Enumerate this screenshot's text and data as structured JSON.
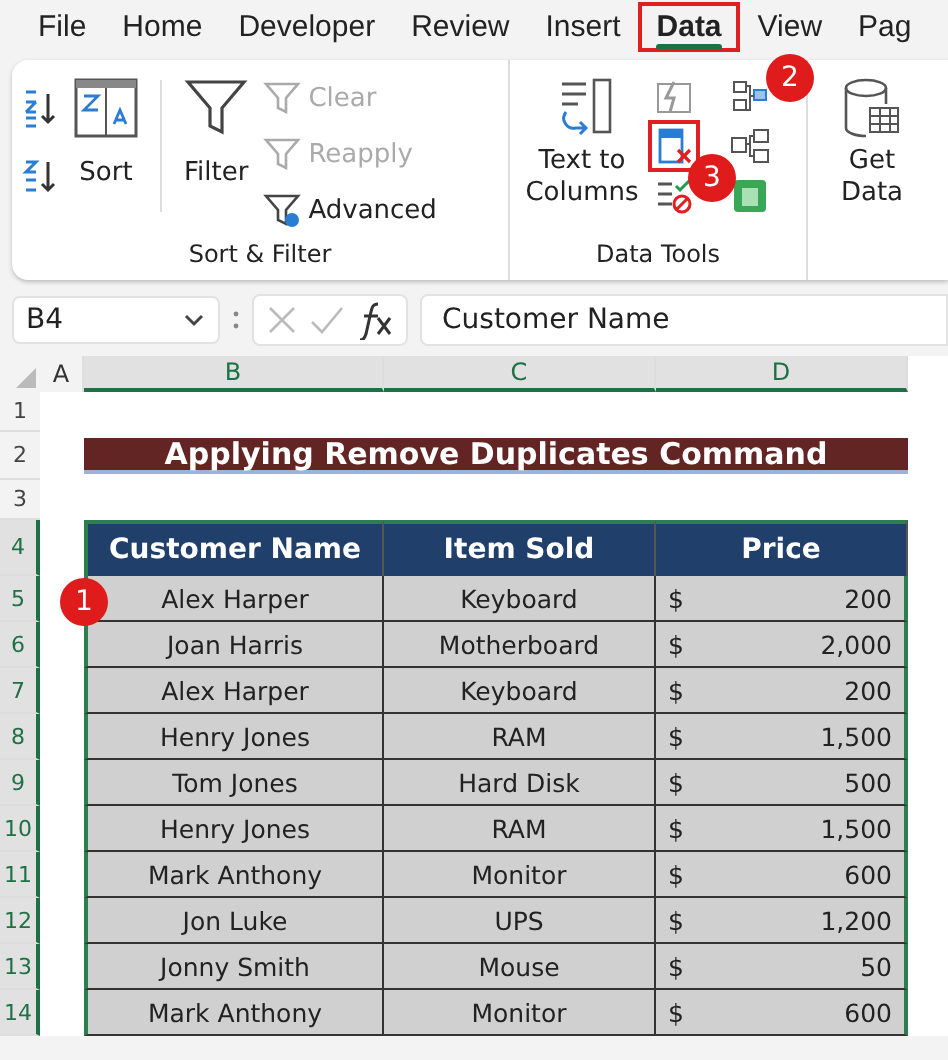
{
  "ribbon_tabs": [
    {
      "label": "File",
      "selected": false
    },
    {
      "label": "Home",
      "selected": false
    },
    {
      "label": "Developer",
      "selected": false
    },
    {
      "label": "Review",
      "selected": false
    },
    {
      "label": "Insert",
      "selected": false
    },
    {
      "label": "Data",
      "selected": true,
      "highlighted": true
    },
    {
      "label": "View",
      "selected": false
    },
    {
      "label": "Pag",
      "selected": false
    }
  ],
  "sort_filter": {
    "label": "Sort & Filter",
    "sort": "Sort",
    "filter": "Filter",
    "clear": {
      "label": "Clear",
      "disabled": true
    },
    "reapply": {
      "label": "Reapply",
      "disabled": true
    },
    "advanced": {
      "label": "Advanced",
      "disabled": false
    }
  },
  "data_tools": {
    "label": "Data Tools",
    "text_to_columns": "Text to Columns",
    "remove_duplicates_highlighted": true
  },
  "get_data": {
    "label": "Get Data"
  },
  "formula_bar": {
    "name_box": "B4",
    "formula": "Customer Name"
  },
  "columns": [
    {
      "label": "A",
      "selected": false
    },
    {
      "label": "B",
      "selected": true
    },
    {
      "label": "C",
      "selected": true
    },
    {
      "label": "D",
      "selected": true
    }
  ],
  "rows": [
    {
      "label": "1",
      "selected": false
    },
    {
      "label": "2",
      "selected": false
    },
    {
      "label": "3",
      "selected": false
    },
    {
      "label": "4",
      "selected": true
    },
    {
      "label": "5",
      "selected": true
    },
    {
      "label": "6",
      "selected": true
    },
    {
      "label": "7",
      "selected": true
    },
    {
      "label": "8",
      "selected": true
    },
    {
      "label": "9",
      "selected": true
    },
    {
      "label": "10",
      "selected": true
    },
    {
      "label": "11",
      "selected": true
    },
    {
      "label": "12",
      "selected": true
    },
    {
      "label": "13",
      "selected": true
    },
    {
      "label": "14",
      "selected": true
    }
  ],
  "sheet_title": "Applying Remove Duplicates Command",
  "table": {
    "headers": [
      "Customer Name",
      "Item Sold",
      "Price"
    ],
    "rows": [
      {
        "name": "Alex Harper",
        "item": "Keyboard",
        "currency": "$",
        "price": "200"
      },
      {
        "name": "Joan Harris",
        "item": "Motherboard",
        "currency": "$",
        "price": "2,000"
      },
      {
        "name": "Alex Harper",
        "item": "Keyboard",
        "currency": "$",
        "price": "200"
      },
      {
        "name": "Henry Jones",
        "item": "RAM",
        "currency": "$",
        "price": "1,500"
      },
      {
        "name": "Tom Jones",
        "item": "Hard Disk",
        "currency": "$",
        "price": "500"
      },
      {
        "name": "Henry Jones",
        "item": "RAM",
        "currency": "$",
        "price": "1,500"
      },
      {
        "name": "Mark Anthony",
        "item": "Monitor",
        "currency": "$",
        "price": "600"
      },
      {
        "name": "Jon Luke",
        "item": "UPS",
        "currency": "$",
        "price": "1,200"
      },
      {
        "name": "Jonny Smith",
        "item": "Mouse",
        "currency": "$",
        "price": "50"
      },
      {
        "name": "Mark Anthony",
        "item": "Monitor",
        "currency": "$",
        "price": "600"
      }
    ]
  },
  "callouts": [
    "1",
    "2",
    "3"
  ]
}
